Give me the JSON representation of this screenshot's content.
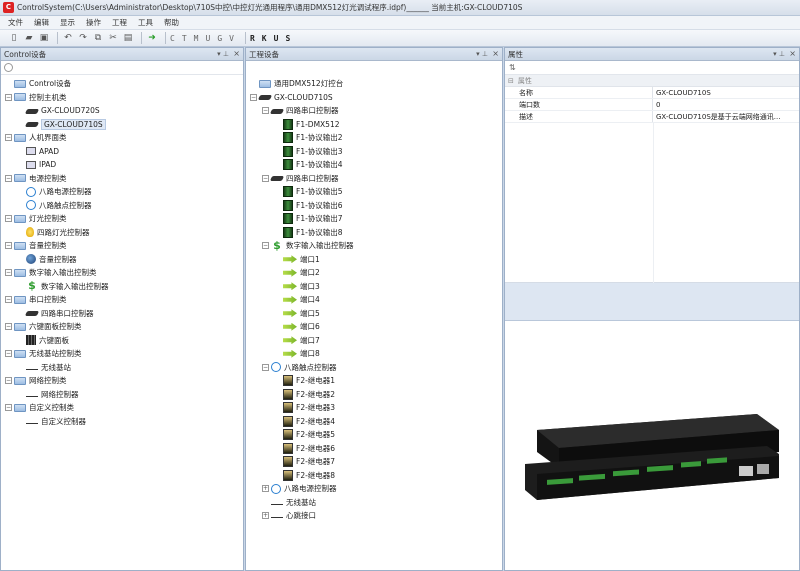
{
  "window": {
    "title": "ControlSystem(C:\\Users\\Administrator\\Desktop\\710S中控\\中控灯光通用程序\\通用DMX512灯光调试程序.idpf)______ 当前主机:GX-CLOUD710S",
    "app_icon_letter": "C"
  },
  "menu": [
    "文件",
    "编辑",
    "显示",
    "操作",
    "工程",
    "工具",
    "帮助"
  ],
  "toolbar": {
    "letters": [
      "C",
      "T",
      "M",
      "U",
      "G",
      "V"
    ],
    "bold_letters": [
      "R",
      "K",
      "U",
      "S"
    ]
  },
  "left_panel": {
    "title": "Control设备",
    "tree": [
      {
        "depth": 0,
        "exp": "",
        "icon": "folder",
        "label": "Control设备"
      },
      {
        "depth": 0,
        "exp": "-",
        "icon": "folder",
        "label": "控制主机类"
      },
      {
        "depth": 1,
        "exp": "",
        "icon": "device",
        "label": "GX-CLOUD720S"
      },
      {
        "depth": 1,
        "exp": "",
        "icon": "device",
        "label": "GX-CLOUD710S",
        "selected": true
      },
      {
        "depth": 0,
        "exp": "-",
        "icon": "folder",
        "label": "人机界面类"
      },
      {
        "depth": 1,
        "exp": "",
        "icon": "monitor",
        "label": "APAD"
      },
      {
        "depth": 1,
        "exp": "",
        "icon": "monitor",
        "label": "IPAD"
      },
      {
        "depth": 0,
        "exp": "-",
        "icon": "folder",
        "label": "电源控制类"
      },
      {
        "depth": 1,
        "exp": "",
        "icon": "power",
        "label": "八路电源控制器"
      },
      {
        "depth": 1,
        "exp": "",
        "icon": "power",
        "label": "八路触点控制器"
      },
      {
        "depth": 0,
        "exp": "-",
        "icon": "folder",
        "label": "灯光控制类"
      },
      {
        "depth": 1,
        "exp": "",
        "icon": "bulb",
        "label": "四路灯光控制器"
      },
      {
        "depth": 0,
        "exp": "-",
        "icon": "folder",
        "label": "音量控制类"
      },
      {
        "depth": 1,
        "exp": "",
        "icon": "disc",
        "label": "音量控制器"
      },
      {
        "depth": 0,
        "exp": "-",
        "icon": "folder",
        "label": "数字输入输出控制类"
      },
      {
        "depth": 1,
        "exp": "",
        "icon": "dollar",
        "label": "数字输入输出控制器"
      },
      {
        "depth": 0,
        "exp": "-",
        "icon": "folder",
        "label": "串口控制类"
      },
      {
        "depth": 1,
        "exp": "",
        "icon": "device",
        "label": "四路串口控制器"
      },
      {
        "depth": 0,
        "exp": "-",
        "icon": "folder",
        "label": "六键面板控制类"
      },
      {
        "depth": 1,
        "exp": "",
        "icon": "grid",
        "label": "六键面板"
      },
      {
        "depth": 0,
        "exp": "-",
        "icon": "folder",
        "label": "无线基站控制类"
      },
      {
        "depth": 1,
        "exp": "",
        "icon": "wave",
        "label": "无线基站"
      },
      {
        "depth": 0,
        "exp": "-",
        "icon": "folder",
        "label": "网络控制类"
      },
      {
        "depth": 1,
        "exp": "",
        "icon": "line",
        "label": "网络控制器"
      },
      {
        "depth": 0,
        "exp": "-",
        "icon": "folder",
        "label": "自定义控制类"
      },
      {
        "depth": 1,
        "exp": "",
        "icon": "line",
        "label": "自定义控制器"
      }
    ]
  },
  "mid_panel": {
    "title": "工程设备",
    "tree": [
      {
        "depth": 0,
        "exp": "",
        "icon": "folder",
        "label": "通用DMX512灯控台"
      },
      {
        "depth": 0,
        "exp": "-",
        "icon": "device",
        "label": "GX-CLOUD710S"
      },
      {
        "depth": 1,
        "exp": "-",
        "icon": "device",
        "label": "四路串口控制器"
      },
      {
        "depth": 2,
        "exp": "",
        "icon": "green",
        "label": "F1-DMX512"
      },
      {
        "depth": 2,
        "exp": "",
        "icon": "green",
        "label": "F1-协议输出2"
      },
      {
        "depth": 2,
        "exp": "",
        "icon": "green",
        "label": "F1-协议输出3"
      },
      {
        "depth": 2,
        "exp": "",
        "icon": "green",
        "label": "F1-协议输出4"
      },
      {
        "depth": 1,
        "exp": "-",
        "icon": "device",
        "label": "四路串口控制器"
      },
      {
        "depth": 2,
        "exp": "",
        "icon": "green",
        "label": "F1-协议输出5"
      },
      {
        "depth": 2,
        "exp": "",
        "icon": "green",
        "label": "F1-协议输出6"
      },
      {
        "depth": 2,
        "exp": "",
        "icon": "green",
        "label": "F1-协议输出7"
      },
      {
        "depth": 2,
        "exp": "",
        "icon": "green",
        "label": "F1-协议输出8"
      },
      {
        "depth": 1,
        "exp": "-",
        "icon": "dollar",
        "label": "数字输入输出控制器"
      },
      {
        "depth": 2,
        "exp": "",
        "icon": "arrow",
        "label": "端口1"
      },
      {
        "depth": 2,
        "exp": "",
        "icon": "arrow",
        "label": "端口2"
      },
      {
        "depth": 2,
        "exp": "",
        "icon": "arrow",
        "label": "端口3"
      },
      {
        "depth": 2,
        "exp": "",
        "icon": "arrow",
        "label": "端口4"
      },
      {
        "depth": 2,
        "exp": "",
        "icon": "arrow",
        "label": "端口5"
      },
      {
        "depth": 2,
        "exp": "",
        "icon": "arrow",
        "label": "端口6"
      },
      {
        "depth": 2,
        "exp": "",
        "icon": "arrow",
        "label": "端口7"
      },
      {
        "depth": 2,
        "exp": "",
        "icon": "arrow",
        "label": "端口8"
      },
      {
        "depth": 1,
        "exp": "-",
        "icon": "power",
        "label": "八路触点控制器"
      },
      {
        "depth": 2,
        "exp": "",
        "icon": "relay",
        "label": "F2-继电器1"
      },
      {
        "depth": 2,
        "exp": "",
        "icon": "relay",
        "label": "F2-继电器2"
      },
      {
        "depth": 2,
        "exp": "",
        "icon": "relay",
        "label": "F2-继电器3"
      },
      {
        "depth": 2,
        "exp": "",
        "icon": "relay",
        "label": "F2-继电器4"
      },
      {
        "depth": 2,
        "exp": "",
        "icon": "relay",
        "label": "F2-继电器5"
      },
      {
        "depth": 2,
        "exp": "",
        "icon": "relay",
        "label": "F2-继电器6"
      },
      {
        "depth": 2,
        "exp": "",
        "icon": "relay",
        "label": "F2-继电器7"
      },
      {
        "depth": 2,
        "exp": "",
        "icon": "relay",
        "label": "F2-继电器8"
      },
      {
        "depth": 1,
        "exp": "+",
        "icon": "power",
        "label": "八路电源控制器"
      },
      {
        "depth": 1,
        "exp": "",
        "icon": "wave",
        "label": "无线基站"
      },
      {
        "depth": 1,
        "exp": "+",
        "icon": "line",
        "label": "心跳接口"
      }
    ]
  },
  "right_panel": {
    "title": "属性",
    "category": "属性",
    "props": [
      {
        "key": "名称",
        "value": "GX-CLOUD710S"
      },
      {
        "key": "端口数",
        "value": "0"
      },
      {
        "key": "描述",
        "value": "GX-CLOUD710S是基于云端网络通讯..."
      }
    ]
  }
}
